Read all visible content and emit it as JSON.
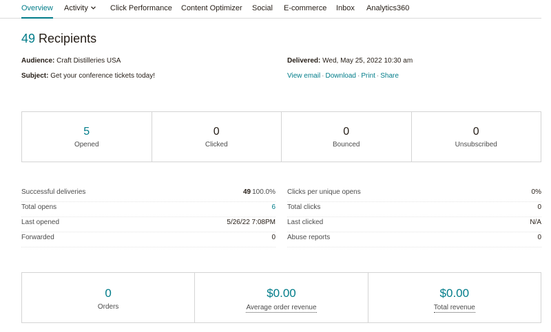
{
  "nav": {
    "items": [
      {
        "label": "Overview"
      },
      {
        "label": "Activity"
      },
      {
        "label": "Click Performance"
      },
      {
        "label": "Content Optimizer"
      },
      {
        "label": "Social"
      },
      {
        "label": "E-commerce"
      },
      {
        "label": "Inbox"
      },
      {
        "label": "Analytics360"
      }
    ],
    "activity_icon": "chevron-down-icon"
  },
  "header": {
    "recipients_count": "49",
    "recipients_label": "Recipients",
    "audience_label": "Audience:",
    "audience_value": "Craft Distilleries USA",
    "subject_label": "Subject:",
    "subject_value": "Get your conference tickets today!",
    "delivered_label": "Delivered:",
    "delivered_value": "Wed, May 25, 2022 10:30 am",
    "links": [
      "View email",
      "Download",
      "Print",
      "Share"
    ],
    "link_separator": "·"
  },
  "stats": [
    {
      "value": "5",
      "label": "Opened"
    },
    {
      "value": "0",
      "label": "Clicked"
    },
    {
      "value": "0",
      "label": "Bounced"
    },
    {
      "value": "0",
      "label": "Unsubscribed"
    }
  ],
  "details_left": [
    {
      "label": "Successful deliveries",
      "value": "49",
      "extra": "100.0%"
    },
    {
      "label": "Total opens",
      "value": "6"
    },
    {
      "label": "Last opened",
      "value": "5/26/22 7:08PM"
    },
    {
      "label": "Forwarded",
      "value": "0"
    }
  ],
  "details_right": [
    {
      "label": "Clicks per unique opens",
      "value": "0%"
    },
    {
      "label": "Total clicks",
      "value": "0"
    },
    {
      "label": "Last clicked",
      "value": "N/A"
    },
    {
      "label": "Abuse reports",
      "value": "0"
    }
  ],
  "revenue": [
    {
      "value": "0",
      "label": "Orders"
    },
    {
      "value": "$0.00",
      "label": "Average order revenue"
    },
    {
      "value": "$0.00",
      "label": "Total revenue"
    }
  ],
  "colors": {
    "accent": "#007c89",
    "text": "#241c15",
    "border": "#d4d4d4"
  }
}
